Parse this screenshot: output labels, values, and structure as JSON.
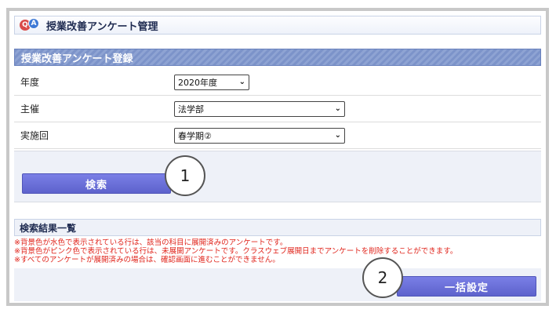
{
  "window": {
    "title": "授業改善アンケート管理"
  },
  "form_section": {
    "heading": "授業改善アンケート登録",
    "fields": [
      {
        "label": "年度",
        "value": "2020年度"
      },
      {
        "label": "主催",
        "value": "法学部"
      },
      {
        "label": "実施回",
        "value": "春学期②"
      }
    ]
  },
  "search": {
    "button_label": "検索"
  },
  "results": {
    "heading": "検索結果一覧",
    "notes": [
      "※背景色が水色で表示されている行は、該当の科目に展開済みのアンケートです。",
      "※背景色がピンク色で表示されている行は、未展開アンケートです。クラスウェブ展開日までアンケートを削除することができます。",
      "※すべてのアンケートが展開済みの場合は、確認画面に進むことができません。"
    ],
    "bulk_button_label": "一括設定"
  },
  "callouts": [
    "1",
    "2"
  ],
  "icons": {
    "logo": "qa-icon",
    "dropdown": "chevron-down-icon"
  },
  "colors": {
    "accent": "#6066d6",
    "header_stripe": "#7c93c9",
    "note_text": "#e0241b"
  }
}
